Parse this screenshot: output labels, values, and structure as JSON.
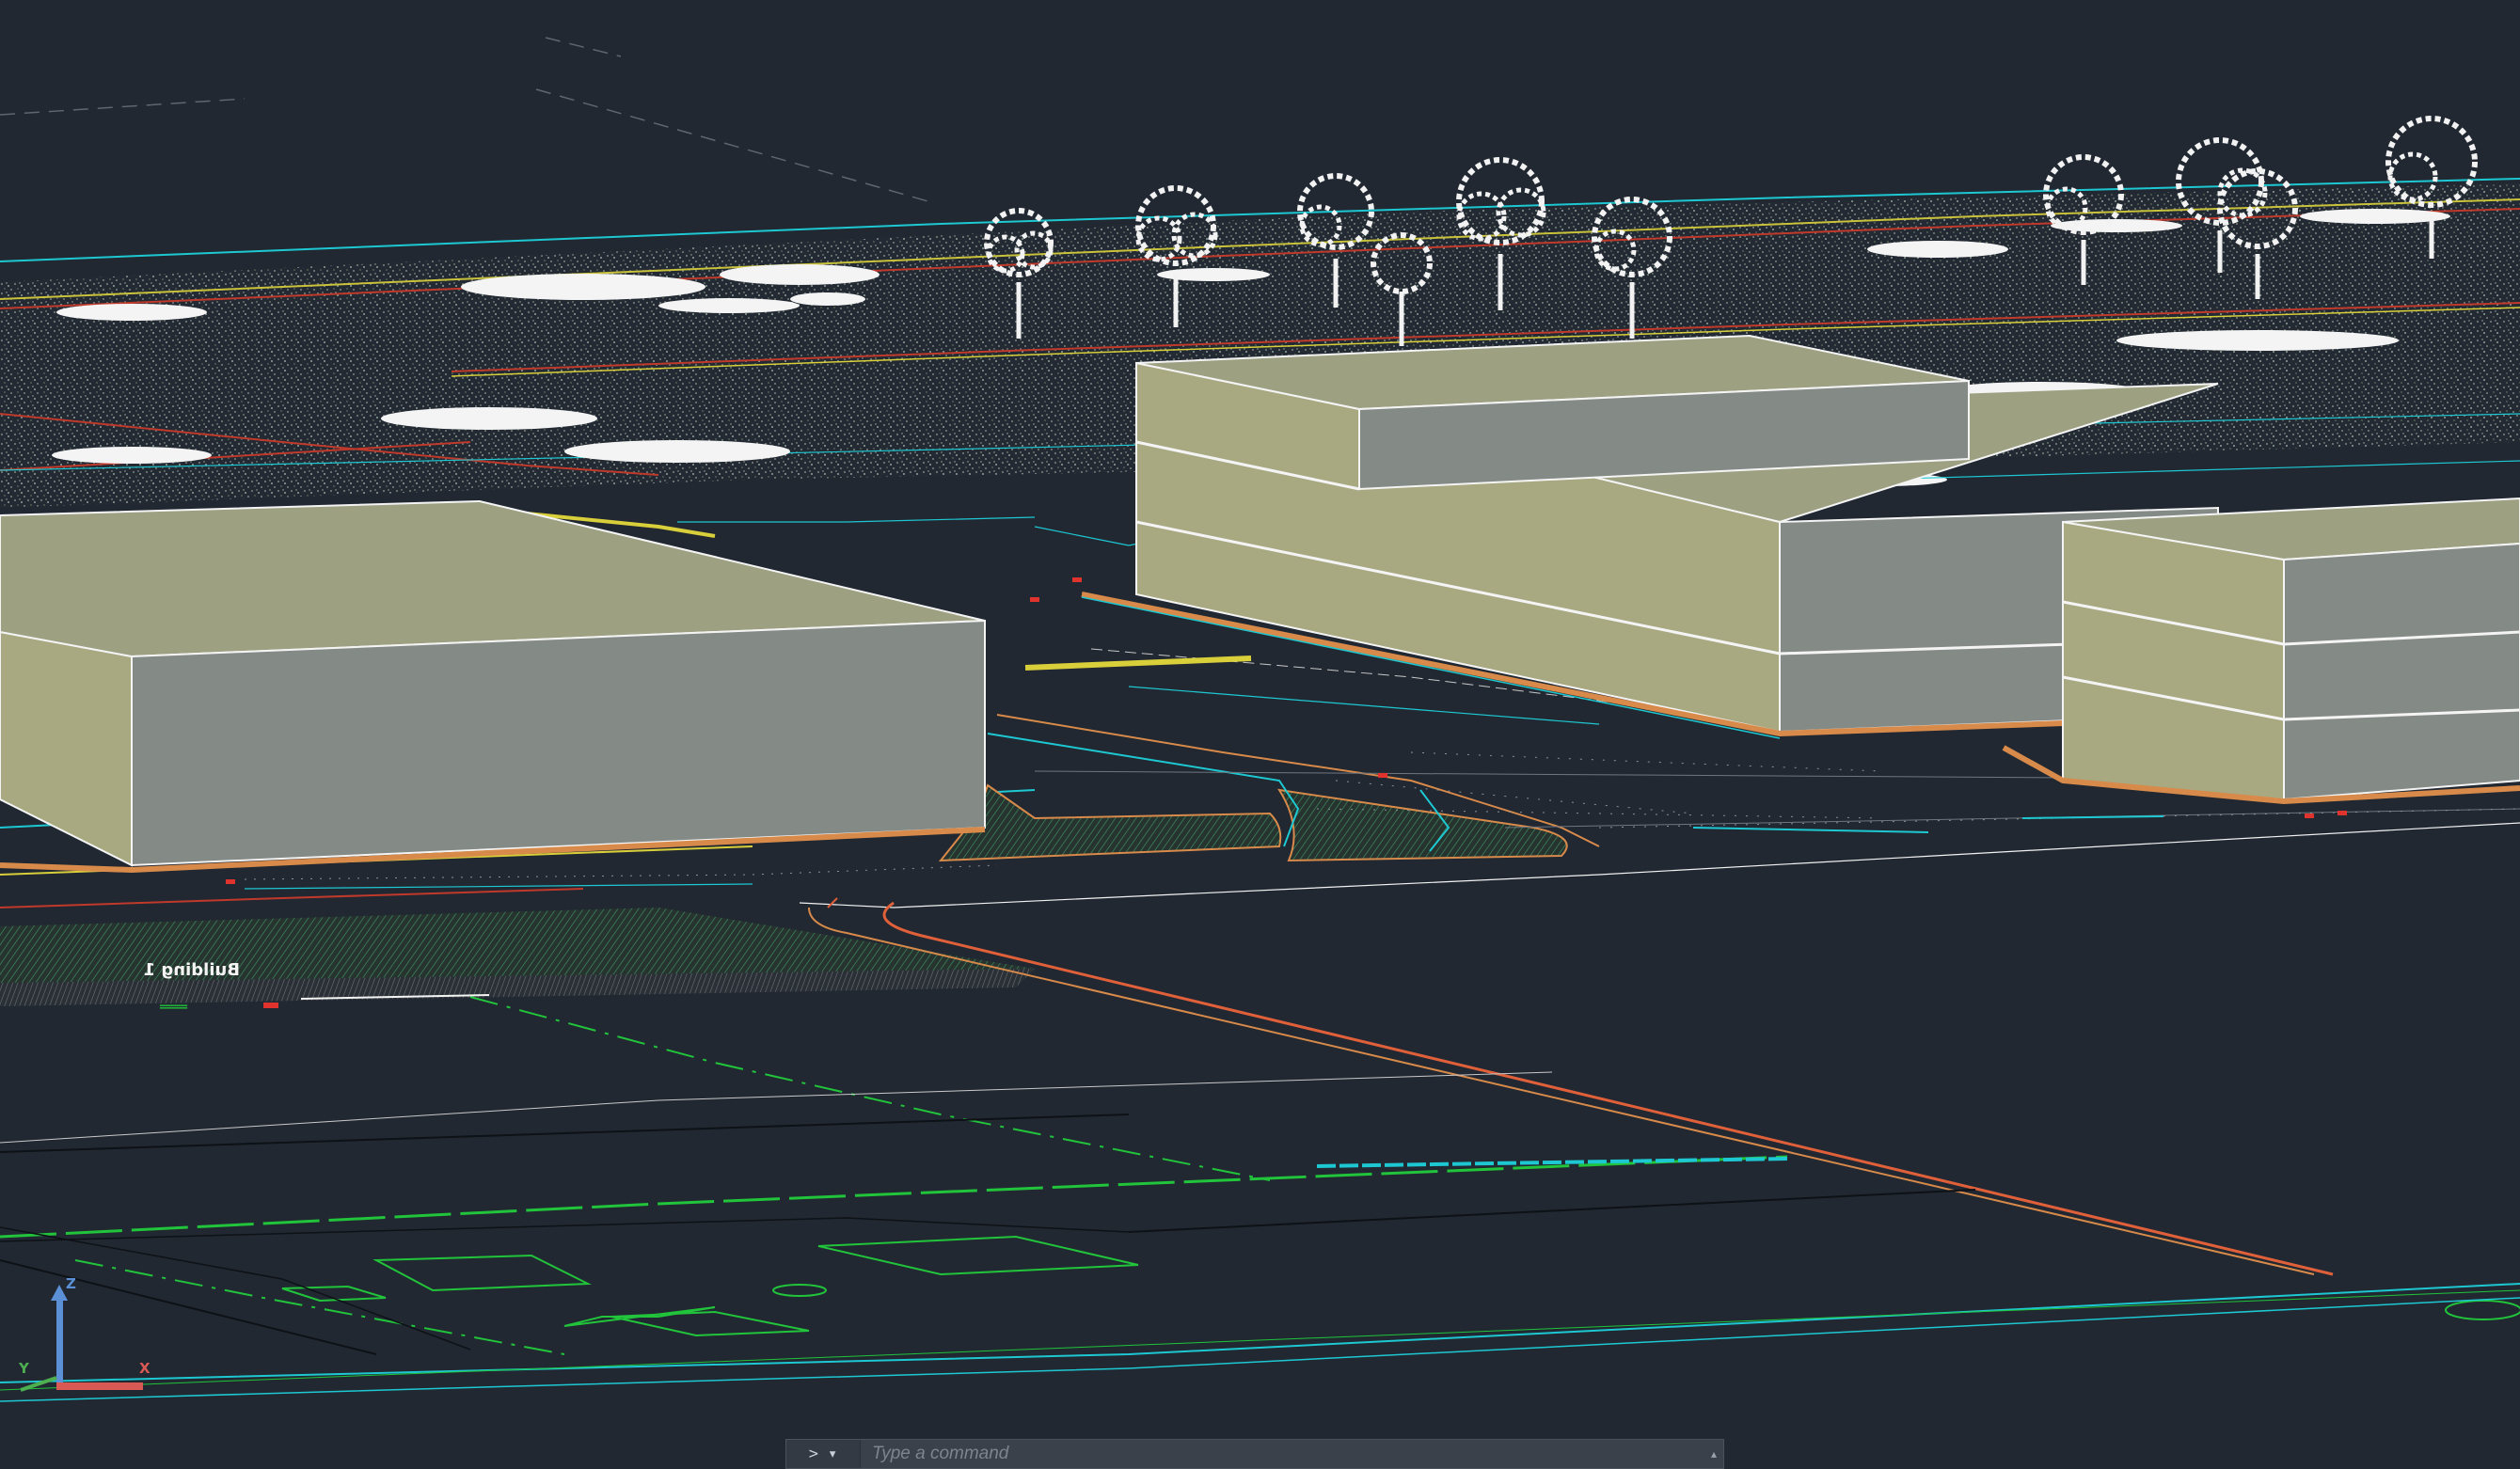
{
  "app": "AutoCAD 3D model view",
  "viewport": {
    "background": "#212832",
    "building_label": "Building 1",
    "ucs_axes": {
      "x": "X",
      "y": "Y",
      "z": "Z"
    }
  },
  "colors": {
    "building_top": "#9da182",
    "building_front": "#a8a881",
    "building_side": "#848a86",
    "cyan": "#1ec8d2",
    "green": "#21c43a",
    "orange": "#d88a4a",
    "red": "#e0332e",
    "tree": "#f2f2f2"
  },
  "command_line": {
    "prompt_icon": ">",
    "dropdown_icon": "▾",
    "placeholder": "Type a command",
    "expand_icon": "▴"
  }
}
